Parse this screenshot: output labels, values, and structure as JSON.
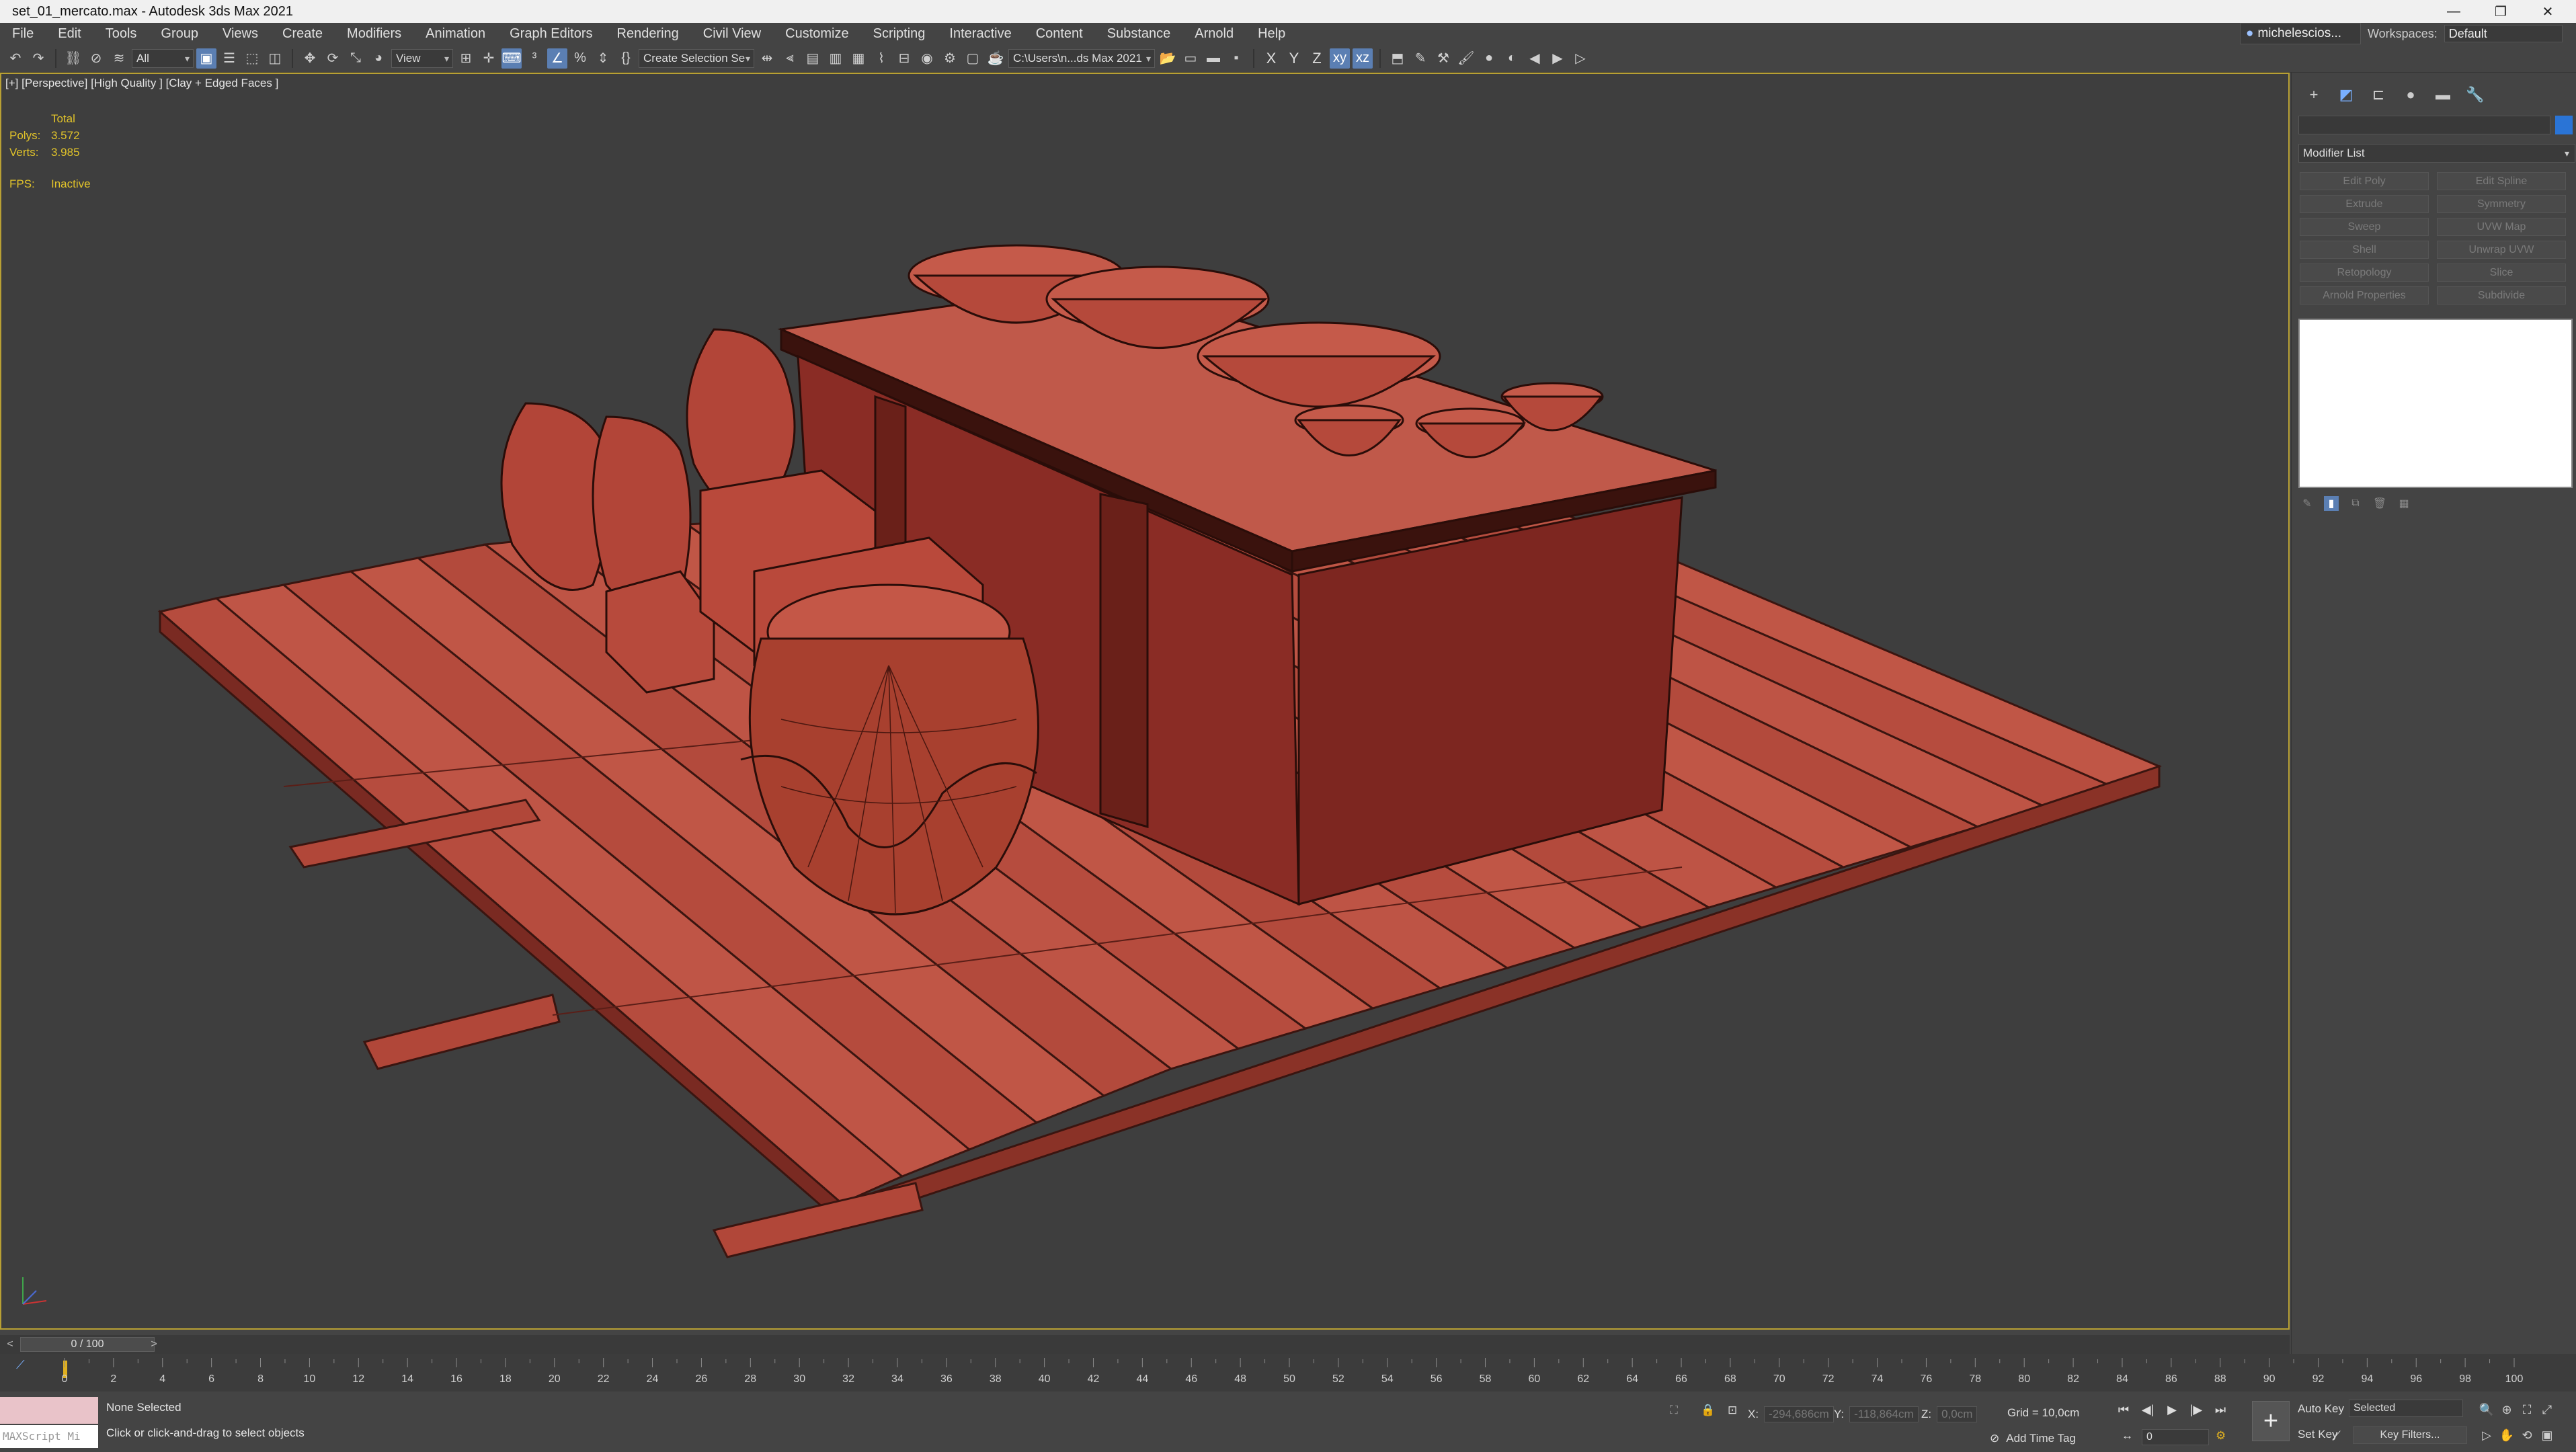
{
  "window": {
    "title": "set_01_mercato.max - Autodesk 3ds Max 2021",
    "controls": [
      "—",
      "❐",
      "✕"
    ]
  },
  "menu": [
    "File",
    "Edit",
    "Tools",
    "Group",
    "Views",
    "Create",
    "Modifiers",
    "Animation",
    "Graph Editors",
    "Rendering",
    "Civil View",
    "Customize",
    "Scripting",
    "Interactive",
    "Content",
    "Substance",
    "Arnold",
    "Help"
  ],
  "user": {
    "name": "michelescios...",
    "workspaces_label": "Workspaces:",
    "workspace": "Default"
  },
  "toolbar": {
    "filter": "All",
    "ref_coord": "View",
    "selection_set": "Create Selection Se",
    "project_path": "C:\\Users\\n...ds Max 2021",
    "axes": [
      "X",
      "Y",
      "Z"
    ]
  },
  "viewport": {
    "label": "[+] [Perspective] [High Quality ] [Clay + Edged Faces ]",
    "stats": {
      "header": "Total",
      "polys_label": "Polys:",
      "polys": "3.572",
      "verts_label": "Verts:",
      "verts": "3.985",
      "fps_label": "FPS:",
      "fps": "Inactive"
    },
    "clay_color": "#b1453a",
    "border_color": "#b8a034"
  },
  "command_panel": {
    "modifier_list": "Modifier List",
    "modifiers": [
      [
        "Edit Poly",
        "Edit Spline"
      ],
      [
        "Extrude",
        "Symmetry"
      ],
      [
        "Sweep",
        "UVW Map"
      ],
      [
        "Shell",
        "Unwrap UVW"
      ],
      [
        "Retopology",
        "Slice"
      ],
      [
        "Arnold Properties",
        "Subdivide"
      ]
    ],
    "object_color": "#2a74d6"
  },
  "timeline": {
    "frame": "0 / 100",
    "ticks": [
      "0",
      "2",
      "4",
      "6",
      "8",
      "10",
      "12",
      "14",
      "16",
      "18",
      "20",
      "22",
      "24",
      "26",
      "28",
      "30",
      "32",
      "34",
      "36",
      "38",
      "40",
      "42",
      "44",
      "46",
      "48",
      "50",
      "52",
      "54",
      "56",
      "58",
      "60",
      "62",
      "64",
      "66",
      "68",
      "70",
      "72",
      "74",
      "76",
      "78",
      "80",
      "82",
      "84",
      "86",
      "88",
      "90",
      "92",
      "94",
      "96",
      "98",
      "100"
    ]
  },
  "status": {
    "maxscript_placeholder": "MAXScript Mi",
    "selection": "None Selected",
    "prompt": "Click or click-and-drag to select objects",
    "x_label": "X:",
    "x": "-294,686cm",
    "y_label": "Y:",
    "y": "-118,864cm",
    "z_label": "Z:",
    "z": "0,0cm",
    "grid": "Grid = 10,0cm",
    "add_time_tag": "Add Time Tag",
    "frame_input": "0",
    "auto_key": "Auto Key",
    "set_key": "Set Key",
    "key_mode": "Selected",
    "key_filters": "Key Filters..."
  }
}
